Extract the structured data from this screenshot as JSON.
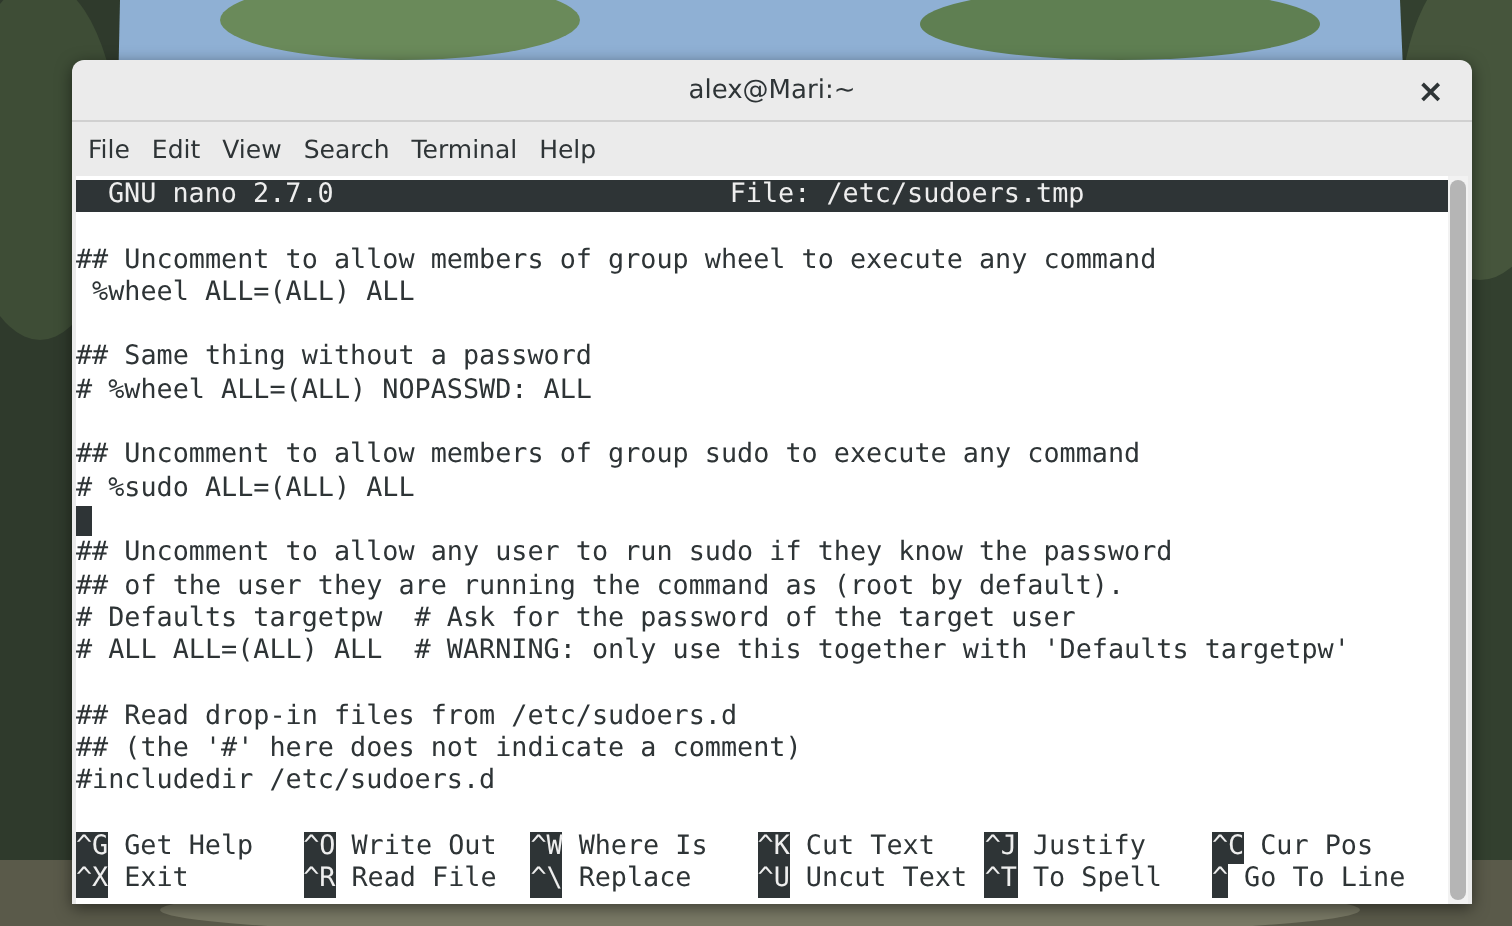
{
  "window": {
    "title": "alex@Mari:~",
    "close": "×"
  },
  "menu": [
    "File",
    "Edit",
    "View",
    "Search",
    "Terminal",
    "Help"
  ],
  "nano": {
    "version": "GNU nano 2.7.0",
    "file": "File: /etc/sudoers.tmp"
  },
  "lines": [
    {
      "kind": "blank"
    },
    {
      "kind": "text",
      "text": "## Uncomment to allow members of group wheel to execute any command"
    },
    {
      "kind": "text",
      "text": " %wheel ALL=(ALL) ALL"
    },
    {
      "kind": "blank"
    },
    {
      "kind": "text",
      "text": "## Same thing without a password"
    },
    {
      "kind": "text",
      "text": "# %wheel ALL=(ALL) NOPASSWD: ALL"
    },
    {
      "kind": "blank"
    },
    {
      "kind": "text",
      "text": "## Uncomment to allow members of group sudo to execute any command"
    },
    {
      "kind": "text",
      "text": "# %sudo ALL=(ALL) ALL"
    },
    {
      "kind": "cursor"
    },
    {
      "kind": "text",
      "text": "## Uncomment to allow any user to run sudo if they know the password"
    },
    {
      "kind": "text",
      "text": "## of the user they are running the command as (root by default)."
    },
    {
      "kind": "text",
      "text": "# Defaults targetpw  # Ask for the password of the target user"
    },
    {
      "kind": "text",
      "text": "# ALL ALL=(ALL) ALL  # WARNING: only use this together with 'Defaults targetpw'"
    },
    {
      "kind": "blank"
    },
    {
      "kind": "text",
      "text": "## Read drop-in files from /etc/sudoers.d"
    },
    {
      "kind": "text",
      "text": "## (the '#' here does not indicate a comment)"
    },
    {
      "kind": "text",
      "text": "#includedir /etc/sudoers.d"
    },
    {
      "kind": "blank"
    }
  ],
  "shortcuts": [
    [
      {
        "key": "^G",
        "label": "Get Help"
      },
      {
        "key": "^O",
        "label": "Write Out"
      },
      {
        "key": "^W",
        "label": "Where Is"
      },
      {
        "key": "^K",
        "label": "Cut Text"
      },
      {
        "key": "^J",
        "label": "Justify"
      },
      {
        "key": "^C",
        "label": "Cur Pos"
      }
    ],
    [
      {
        "key": "^X",
        "label": "Exit"
      },
      {
        "key": "^R",
        "label": "Read File"
      },
      {
        "key": "^\\",
        "label": "Replace"
      },
      {
        "key": "^U",
        "label": "Uncut Text"
      },
      {
        "key": "^T",
        "label": "To Spell"
      },
      {
        "key": "^",
        "label": "Go To Line"
      }
    ]
  ]
}
